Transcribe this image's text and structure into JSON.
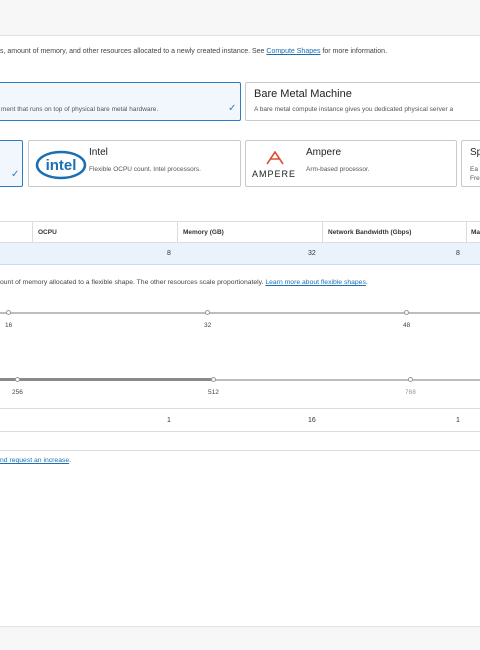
{
  "description": {
    "text": "s, amount of memory, and other resources allocated to a newly created instance. See ",
    "link": "Compute Shapes",
    "suffix": " for more information."
  },
  "shape_types": [
    {
      "title": "",
      "subtitle": "ment that runs on top of physical bare metal hardware.",
      "selected": true
    },
    {
      "title": "Bare Metal Machine",
      "subtitle": "A bare metal compute instance gives you dedicated physical server a",
      "selected": false
    }
  ],
  "processors": [
    {
      "title": "",
      "subtitle": "",
      "selected": true
    },
    {
      "title": "Intel",
      "subtitle": "Flexible OCPU count. Intel processors.",
      "logo_text": "intel",
      "selected": false
    },
    {
      "title": "Ampere",
      "subtitle": "Arm-based processor.",
      "logo_text": "AMPERE",
      "selected": false
    },
    {
      "title": "Sp",
      "subtitle_line1": "Ea",
      "subtitle_line2": "Fre",
      "selected": false
    }
  ],
  "table": {
    "headers": [
      "OCPU",
      "Memory (GB)",
      "Network Bandwidth (Gbps)",
      "Ma"
    ],
    "row": [
      "8",
      "32",
      "8"
    ]
  },
  "flex_note": {
    "text": "ount of memory allocated to a flexible shape. The other resources scale proportionately. ",
    "link": "Learn more about flexible shapes",
    "suffix": "."
  },
  "ocpu_slider": {
    "ticks": [
      "16",
      "32",
      "48"
    ],
    "value_fraction": 0.0
  },
  "memory_slider": {
    "ticks": [
      "256",
      "512",
      "768"
    ],
    "value_fraction": 0.45
  },
  "summary": {
    "values": [
      "1",
      "16",
      "1"
    ]
  },
  "quota_link": {
    "link": "nd request an increase",
    "suffix": "."
  },
  "colors": {
    "accent": "#2c7cc1",
    "link": "#1a6fb3",
    "selected_bg": "#eaf2fb"
  }
}
